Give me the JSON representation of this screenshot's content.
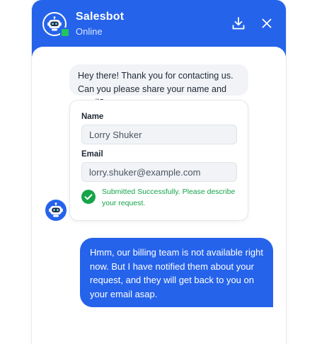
{
  "header": {
    "bot_name": "Salesbot",
    "status": "Online",
    "avatar_icon": "robot-icon",
    "download_icon": "download-icon",
    "close_icon": "close-icon",
    "accent_color": "#2563eb",
    "status_color": "#22c55e"
  },
  "messages": {
    "bot_greeting_line1": "Hey there! Thank you for contacting us.",
    "bot_greeting_line2": "Can you please share your name and email?",
    "user_reply": "Hmm, our billing team is not available right now. But I have notified them about your request, and they will get back to you on your email asap."
  },
  "form": {
    "name_label": "Name",
    "name_value": "Lorry Shuker",
    "email_label": "Email",
    "email_value": "lorry.shuker@example.com",
    "success_message": "Submitted Successfully. Please describe your request.",
    "success_color": "#16a34a"
  }
}
